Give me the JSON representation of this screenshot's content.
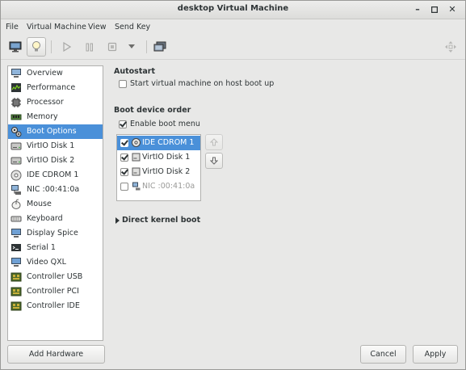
{
  "window": {
    "title": "desktop Virtual Machine"
  },
  "menubar": [
    "File",
    "Virtual Machine",
    "View",
    "Send Key"
  ],
  "sidebar": {
    "items": [
      {
        "label": "Overview",
        "icon": "monitor-icon"
      },
      {
        "label": "Performance",
        "icon": "performance-graph-icon"
      },
      {
        "label": "Processor",
        "icon": "cpu-icon"
      },
      {
        "label": "Memory",
        "icon": "memory-icon"
      },
      {
        "label": "Boot Options",
        "icon": "boot-options-icon"
      },
      {
        "label": "VirtIO Disk 1",
        "icon": "disk-icon"
      },
      {
        "label": "VirtIO Disk 2",
        "icon": "disk-icon"
      },
      {
        "label": "IDE CDROM 1",
        "icon": "cdrom-icon"
      },
      {
        "label": "NIC :00:41:0a",
        "icon": "network-icon"
      },
      {
        "label": "Mouse",
        "icon": "mouse-icon"
      },
      {
        "label": "Keyboard",
        "icon": "keyboard-icon"
      },
      {
        "label": "Display Spice",
        "icon": "display-icon"
      },
      {
        "label": "Serial 1",
        "icon": "serial-icon"
      },
      {
        "label": "Video QXL",
        "icon": "video-icon"
      },
      {
        "label": "Controller USB",
        "icon": "controller-icon"
      },
      {
        "label": "Controller PCI",
        "icon": "controller-icon"
      },
      {
        "label": "Controller IDE",
        "icon": "controller-icon"
      }
    ],
    "selected": "Boot Options"
  },
  "autostart": {
    "heading": "Autostart",
    "checkbox_label": "Start virtual machine on host boot up",
    "checked": false
  },
  "boot_order": {
    "heading": "Boot device order",
    "enable_menu_label": "Enable boot menu",
    "enable_menu_checked": true,
    "devices": [
      {
        "label": "IDE CDROM 1",
        "checked": true,
        "icon": "cdrom-icon"
      },
      {
        "label": "VirtIO Disk 1",
        "checked": true,
        "icon": "disk-icon"
      },
      {
        "label": "VirtIO Disk 2",
        "checked": true,
        "icon": "disk-icon"
      },
      {
        "label": "NIC :00:41:0a",
        "checked": false,
        "icon": "network-icon"
      }
    ]
  },
  "direct_kernel": {
    "label": "Direct kernel boot"
  },
  "buttons": {
    "add_hardware": "Add Hardware",
    "cancel": "Cancel",
    "apply": "Apply"
  },
  "colors": {
    "selection": "#4a90d9",
    "window_bg": "#e8e8e7"
  }
}
